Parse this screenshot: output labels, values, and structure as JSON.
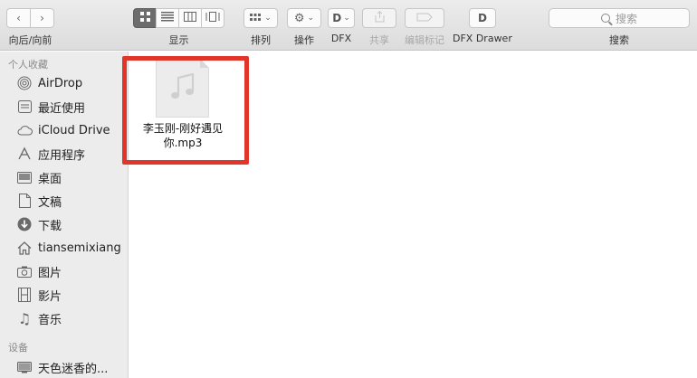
{
  "toolbar": {
    "nav_label": "向后/向前",
    "view_label": "显示",
    "arrange_label": "排列",
    "action_label": "操作",
    "dfx_label": "DFX",
    "share_label": "共享",
    "tags_label": "编辑标记",
    "dfx_drawer_label": "DFX Drawer",
    "search_label": "搜索",
    "search_placeholder": "搜索"
  },
  "sidebar": {
    "favorites_title": "个人收藏",
    "items": [
      {
        "label": "AirDrop",
        "icon": "airdrop-icon"
      },
      {
        "label": "最近使用",
        "icon": "recents-icon"
      },
      {
        "label": "iCloud Drive",
        "icon": "cloud-icon"
      },
      {
        "label": "应用程序",
        "icon": "applications-icon"
      },
      {
        "label": "桌面",
        "icon": "desktop-icon"
      },
      {
        "label": "文稿",
        "icon": "documents-icon"
      },
      {
        "label": "下载",
        "icon": "downloads-icon"
      },
      {
        "label": "tiansemixiang",
        "icon": "home-icon"
      },
      {
        "label": "图片",
        "icon": "pictures-icon"
      },
      {
        "label": "影片",
        "icon": "movies-icon"
      },
      {
        "label": "音乐",
        "icon": "music-icon"
      }
    ],
    "devices_title": "设备",
    "devices": [
      {
        "label": "天色迷香的...",
        "icon": "computer-icon"
      }
    ]
  },
  "main": {
    "file": {
      "name_line1": "李玉刚-刚好遇见",
      "name_line2": "你.mp3",
      "icon": "music-note-icon"
    }
  },
  "colors": {
    "highlight": "#e2352a",
    "active_view": "#6d6d6d"
  }
}
